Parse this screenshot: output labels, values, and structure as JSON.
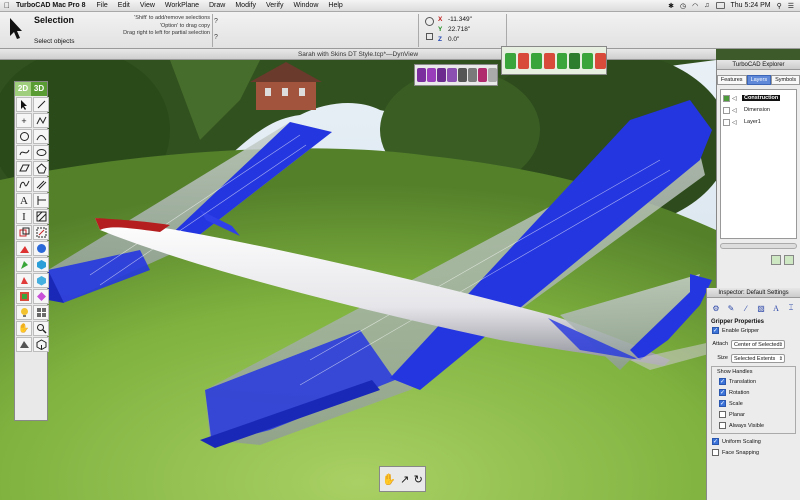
{
  "menubar": {
    "app_name": "TurboCAD Mac Pro 8",
    "items": [
      "File",
      "Edit",
      "View",
      "WorkPlane",
      "Draw",
      "Modify",
      "Verify",
      "Window",
      "Help"
    ],
    "clock": "Thu 5:24 PM"
  },
  "options_bar": {
    "title": "Selection",
    "subtitle": "Select objects",
    "hints": [
      "'Shift' to add/remove selections",
      "'Option' to drag copy",
      "Drag right to left for partial selection"
    ],
    "help_glyph": "?",
    "coords": {
      "x_label": "X",
      "x_value": "-11.349\"",
      "y_label": "Y",
      "y_value": "22.718\"",
      "z_label": "Z",
      "z_value": "0.0\""
    }
  },
  "document": {
    "title": "Sarah with Skins DT Style.tcp*—DynView"
  },
  "toolbox": {
    "modes": [
      "2D",
      "3D"
    ],
    "tools": [
      "select-arrow",
      "pointer",
      "line",
      "polyline",
      "point",
      "circle",
      "arc",
      "curve",
      "rectangle",
      "polygon",
      "curve-tool",
      "double-line",
      "text",
      "dimension",
      "hatch",
      "block",
      "insert",
      "transform",
      "tangent",
      "paint",
      "light",
      "sphere",
      "extrude",
      "box",
      "revolve",
      "solid",
      "sweep",
      "mesh",
      "light-bulb",
      "render",
      "hand",
      "magnify",
      "camera",
      "cube-view"
    ]
  },
  "explorer": {
    "title": "TurboCAD Explorer",
    "tabs": [
      "Features",
      "Layers",
      "Symbols"
    ],
    "active_tab": "Layers",
    "layers": [
      {
        "name": "Construction",
        "selected": true
      },
      {
        "name": "Dimension",
        "selected": false
      },
      {
        "name": "Layer1",
        "selected": false
      }
    ]
  },
  "inspector": {
    "title": "Inspector: Default Settings",
    "section": "Gripper Properties",
    "enable_label": "Enable Gripper",
    "attach_label": "Attach",
    "attach_value": "Center of Selected",
    "size_label": "Size",
    "size_value": "Selected Extents",
    "show_handles_label": "Show Handles",
    "handles": [
      {
        "label": "Translation",
        "checked": true
      },
      {
        "label": "Rotation",
        "checked": true
      },
      {
        "label": "Scale",
        "checked": true
      },
      {
        "label": "Planar",
        "checked": false
      },
      {
        "label": "Always Visible",
        "checked": false
      }
    ],
    "uniform_label": "Uniform Scaling",
    "face_label": "Face Snapping"
  },
  "colors": {
    "wing_blue": "#2436e0",
    "accent_green": "#4d9a3b"
  }
}
